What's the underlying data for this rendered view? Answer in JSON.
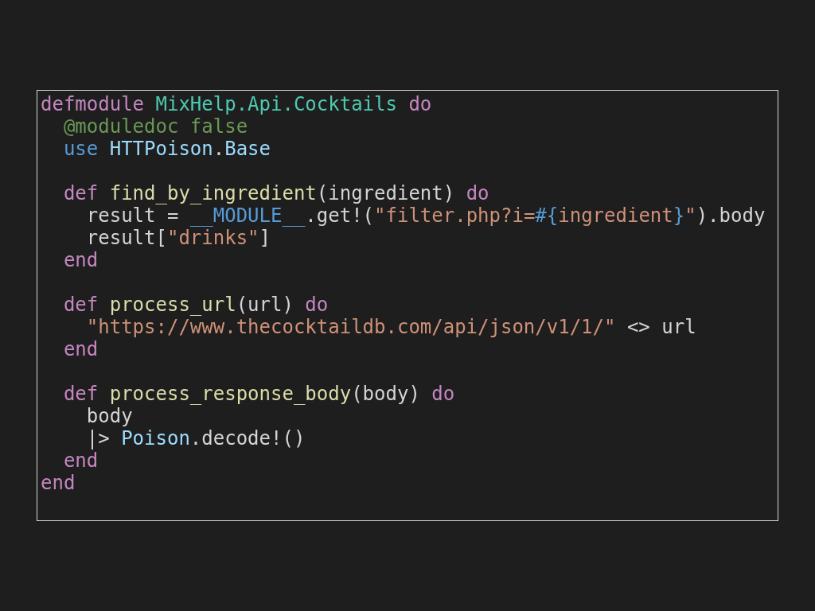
{
  "code_block": {
    "blocks": [
      {
        "lines": [
          {
            "tokens": [
              {
                "kind": "keyword",
                "text": "defmodule "
              },
              {
                "kind": "module",
                "text": "MixHelp.Api.Cocktails "
              },
              {
                "kind": "keyword",
                "text": "do"
              }
            ]
          },
          {
            "tokens": [
              {
                "kind": "attribute",
                "text": "  @moduledoc false"
              }
            ]
          },
          {
            "tokens": [
              {
                "kind": "storage",
                "text": "  use "
              },
              {
                "kind": "type",
                "text": "HTTPoison"
              },
              {
                "kind": "plain",
                "text": "."
              },
              {
                "kind": "type",
                "text": "Base"
              }
            ]
          }
        ]
      },
      {
        "lines": [
          {
            "tokens": [
              {
                "kind": "keyword",
                "text": "  def "
              },
              {
                "kind": "function",
                "text": "find_by_ingredient"
              },
              {
                "kind": "plain",
                "text": "(ingredient) "
              },
              {
                "kind": "keyword",
                "text": "do"
              }
            ]
          },
          {
            "tokens": [
              {
                "kind": "plain",
                "text": "    result = "
              },
              {
                "kind": "constant",
                "text": "__MODULE__"
              },
              {
                "kind": "plain",
                "text": ".get!("
              },
              {
                "kind": "string",
                "text": "\"filter.php?i="
              },
              {
                "kind": "interpolation",
                "text": "#{"
              },
              {
                "kind": "string",
                "text": "ingredient"
              },
              {
                "kind": "interpolation",
                "text": "}"
              },
              {
                "kind": "string",
                "text": "\""
              },
              {
                "kind": "plain",
                "text": ").body"
              }
            ]
          },
          {
            "tokens": [
              {
                "kind": "plain",
                "text": "    result["
              },
              {
                "kind": "string",
                "text": "\"drinks\""
              },
              {
                "kind": "plain",
                "text": "]"
              }
            ]
          },
          {
            "tokens": [
              {
                "kind": "keyword",
                "text": "  end"
              }
            ]
          }
        ]
      },
      {
        "lines": [
          {
            "tokens": [
              {
                "kind": "keyword",
                "text": "  def "
              },
              {
                "kind": "function",
                "text": "process_url"
              },
              {
                "kind": "plain",
                "text": "(url) "
              },
              {
                "kind": "keyword",
                "text": "do"
              }
            ]
          },
          {
            "tokens": [
              {
                "kind": "string",
                "text": "    \"https://www.thecocktaildb.com/api/json/v1/1/\""
              },
              {
                "kind": "plain",
                "text": " <> url"
              }
            ]
          },
          {
            "tokens": [
              {
                "kind": "keyword",
                "text": "  end"
              }
            ]
          }
        ]
      },
      {
        "lines": [
          {
            "tokens": [
              {
                "kind": "keyword",
                "text": "  def "
              },
              {
                "kind": "function",
                "text": "process_response_body"
              },
              {
                "kind": "plain",
                "text": "(body) "
              },
              {
                "kind": "keyword",
                "text": "do"
              }
            ]
          },
          {
            "tokens": [
              {
                "kind": "plain",
                "text": "    body"
              }
            ]
          },
          {
            "tokens": [
              {
                "kind": "plain",
                "text": "    |> "
              },
              {
                "kind": "type",
                "text": "Poison"
              },
              {
                "kind": "plain",
                "text": ".decode!()"
              }
            ]
          },
          {
            "tokens": [
              {
                "kind": "keyword",
                "text": "  end"
              }
            ]
          },
          {
            "tokens": [
              {
                "kind": "keyword",
                "text": "end"
              }
            ]
          }
        ]
      }
    ]
  }
}
